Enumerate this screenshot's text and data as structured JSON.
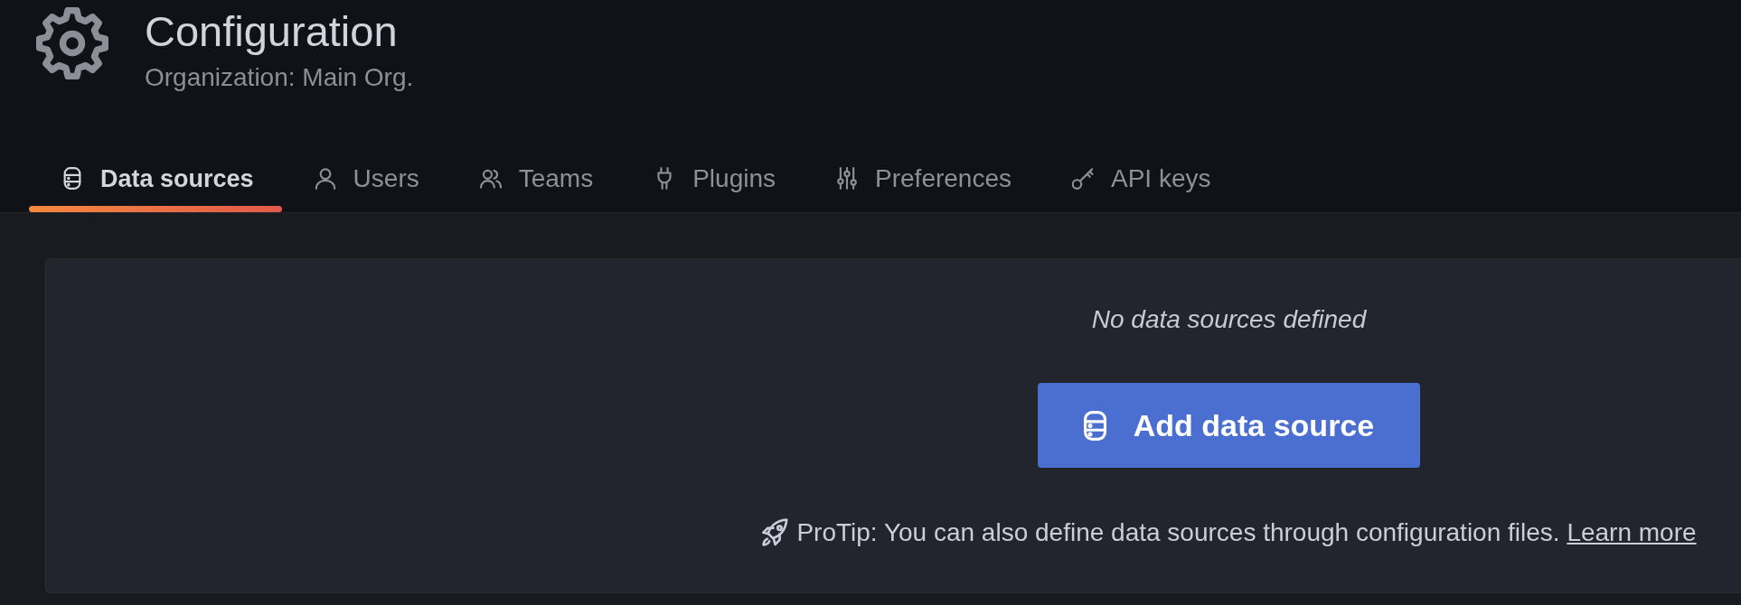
{
  "page_header": {
    "title": "Configuration",
    "subtitle": "Organization: Main Org."
  },
  "tabs": [
    {
      "label": "Data sources",
      "kind": "database",
      "selected": true
    },
    {
      "label": "Users",
      "kind": "user",
      "selected": false
    },
    {
      "label": "Teams",
      "kind": "team",
      "selected": false
    },
    {
      "label": "Plugins",
      "kind": "plug",
      "selected": false
    },
    {
      "label": "Preferences",
      "kind": "sliders",
      "selected": false
    },
    {
      "label": "API keys",
      "kind": "key",
      "selected": false
    }
  ],
  "empty_state": {
    "message": "No data sources defined",
    "button": {
      "label": "Add data source"
    },
    "protip": {
      "text": "ProTip: You can also define data sources through configuration files.",
      "link": "Learn more"
    }
  }
}
